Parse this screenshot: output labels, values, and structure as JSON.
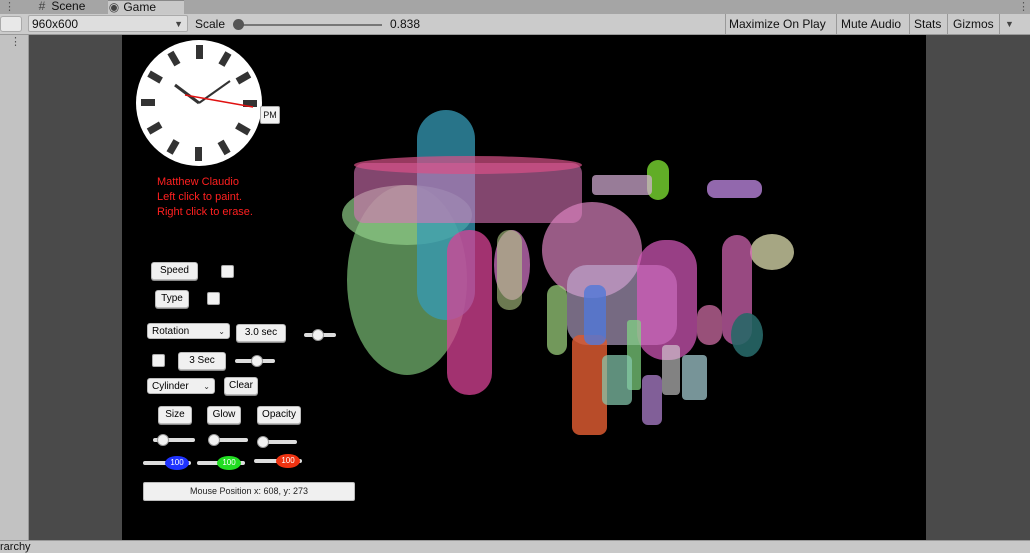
{
  "tabs": [
    {
      "label": "Scene",
      "icon": "grid-icon"
    },
    {
      "label": "Game",
      "icon": "gamepad-icon"
    }
  ],
  "toolbar": {
    "resolution": "960x600",
    "scale_label": "Scale",
    "scale_value": "0.838",
    "maximize": "Maximize On Play",
    "mute": "Mute Audio",
    "stats": "Stats",
    "gizmos": "Gizmos"
  },
  "overlay": {
    "clock_ampm": "PM",
    "instructions": [
      "Matthew Claudio",
      "Left click to paint.",
      "Right click to erase."
    ],
    "speed_button": "Speed",
    "type_button": "Type",
    "rotation_dropdown": "Rotation",
    "duration_button": "3.0 sec",
    "interval_button": "3 Sec",
    "shape_dropdown": "Cylinder",
    "clear_button": "Clear",
    "size_button": "Size",
    "glow_button": "Glow",
    "opacity_button": "Opacity",
    "color_values": [
      "100",
      "100",
      "100"
    ],
    "mouse_position": "Mouse Position x: 608, y: 273"
  },
  "footer": {
    "label": "rarchy"
  },
  "colors": {
    "text_red": "#ff2020",
    "blue": "#1f33ff",
    "green": "#22dd22",
    "red": "#ee3311"
  }
}
